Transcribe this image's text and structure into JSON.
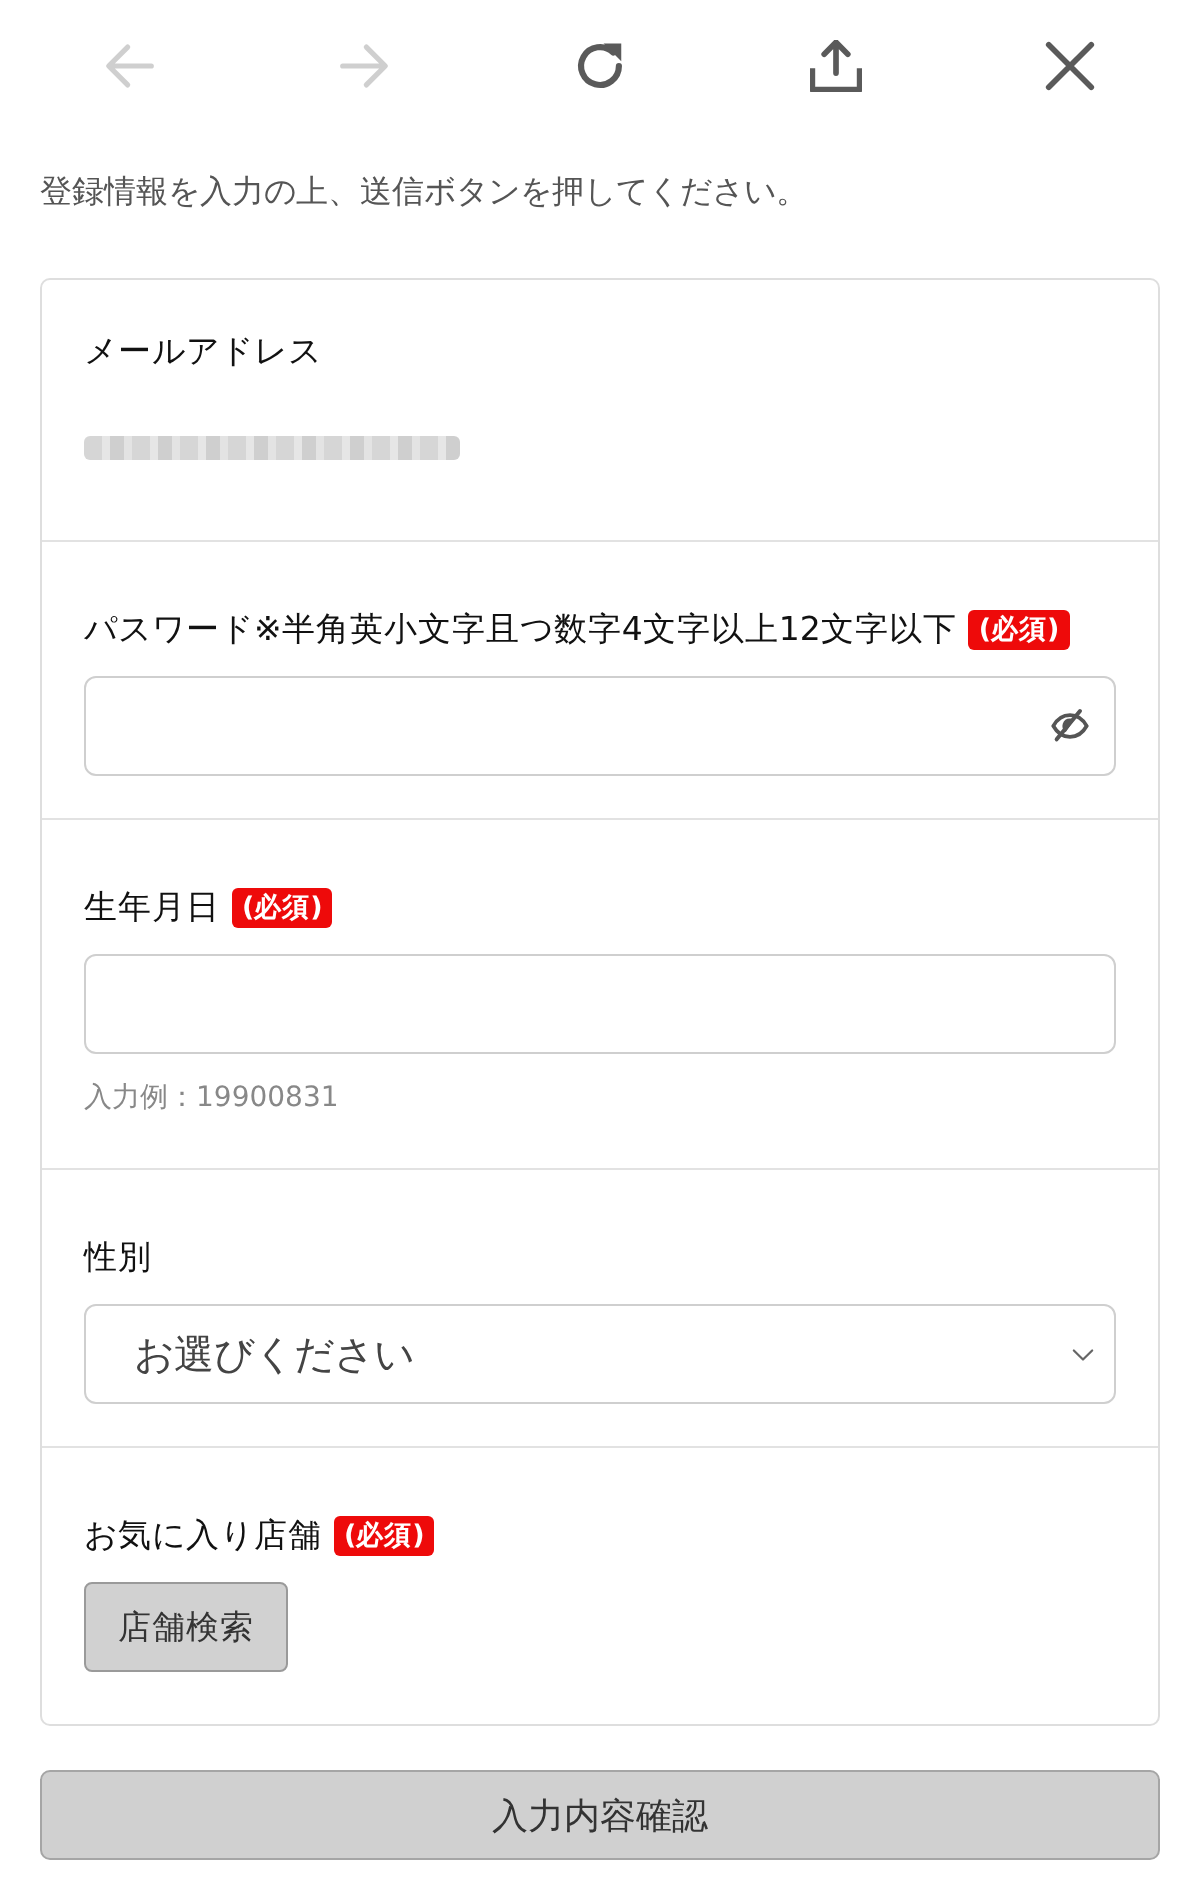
{
  "toolbar": [
    {
      "kind": "back",
      "disabled": true
    },
    {
      "kind": "forward",
      "disabled": true
    },
    {
      "kind": "reload",
      "disabled": false
    },
    {
      "kind": "share",
      "disabled": false
    },
    {
      "kind": "close",
      "disabled": false
    }
  ],
  "intro": "登録情報を入力の上、送信ボタンを押してください。",
  "fields": [
    {
      "kind": "display",
      "label": "メールアドレス",
      "redacted": true
    },
    {
      "kind": "password",
      "label": "パスワード※半角英小文字且つ数字4文字以上12文字以下",
      "badge": "(必須)"
    },
    {
      "kind": "text",
      "label": "生年月日",
      "badge": "(必須)",
      "hint": "入力例：19900831"
    },
    {
      "kind": "select",
      "label": "性別",
      "value": "お選びください"
    },
    {
      "kind": "search",
      "label": "お気に入り店舗",
      "badge": "(必須)",
      "button": "店舗検索"
    }
  ],
  "submit": "入力内容確認"
}
